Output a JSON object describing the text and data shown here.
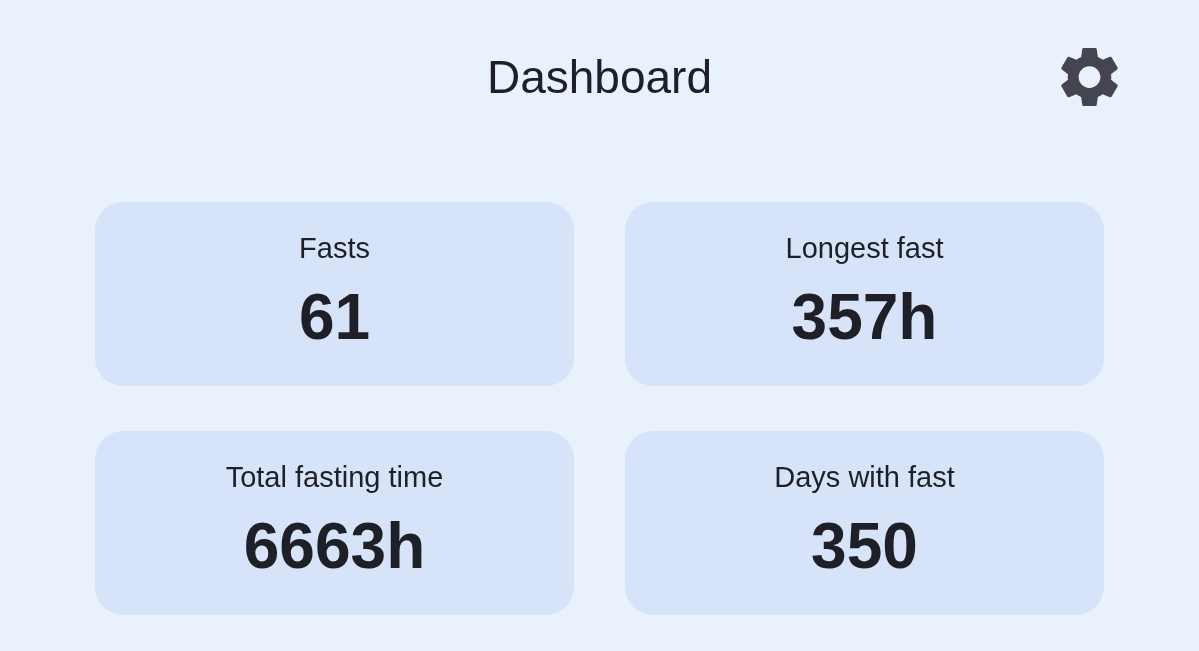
{
  "header": {
    "title": "Dashboard"
  },
  "stats": [
    {
      "label": "Fasts",
      "value": "61"
    },
    {
      "label": "Longest fast",
      "value": "357h"
    },
    {
      "label": "Total fasting time",
      "value": "6663h"
    },
    {
      "label": "Days with fast",
      "value": "350"
    }
  ]
}
